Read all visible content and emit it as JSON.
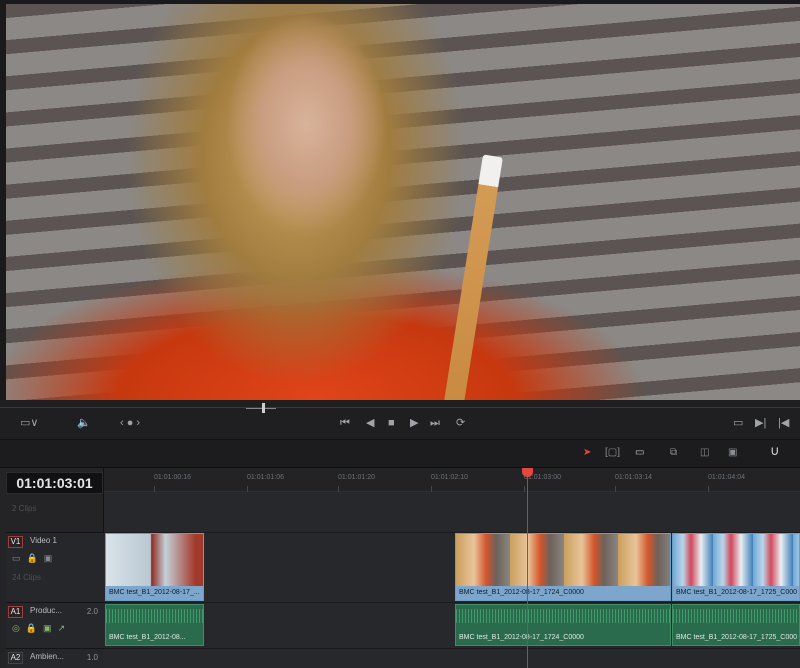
{
  "viewer": {
    "description_icon": "video-preview"
  },
  "transport": {
    "viewer_mode_label": "▭∨",
    "audio_icon": "speaker-icon",
    "nav_label": "‹ ● ›",
    "buttons": [
      "⏮",
      "◀",
      "■",
      "▶",
      "⏭",
      "⟳"
    ],
    "right_buttons": [
      "▭",
      "▶|",
      "|◀"
    ]
  },
  "toolbar": {
    "tools": [
      "selection-tool",
      "trim-tool",
      "blade-tool",
      "insert-clip",
      "overwrite-clip",
      "replace-clip",
      "snapping"
    ]
  },
  "timecode": "01:01:03:01",
  "ruler": {
    "labels": [
      "01:01:00:16",
      "01:01:01:06",
      "01:01:01:20",
      "01:01:02:10",
      "01:01:03:00",
      "01:01:03:14",
      "01:01:04:04"
    ]
  },
  "tracks": {
    "top_clips": "2 Clips",
    "v1": {
      "tag": "V1",
      "name": "Video 1",
      "clips": "24 Clips"
    },
    "a1": {
      "tag": "A1",
      "name": "Produc...",
      "level": "2.0"
    },
    "a2": {
      "tag": "A2",
      "name": "Ambien...",
      "level": "1.0"
    }
  },
  "video_clips": [
    {
      "label": "BMC test_B1_2012-08-17_..."
    },
    {
      "label": "BMC test_B1_2012-08-17_1724_C0000"
    },
    {
      "label": "BMC test_B1_2012-08-17_1725_C000"
    }
  ],
  "audio_clips": [
    {
      "label": "BMC test_B1_2012-08..."
    },
    {
      "label": "BMC test_B1_2012-08-17_1724_C0000"
    },
    {
      "label": "BMC test_B1_2012-08-17_1725_C000"
    }
  ],
  "colors": {
    "accent": "#e5473f",
    "video_clip": "#7ea6cd",
    "audio_clip": "#2b6b4d"
  }
}
